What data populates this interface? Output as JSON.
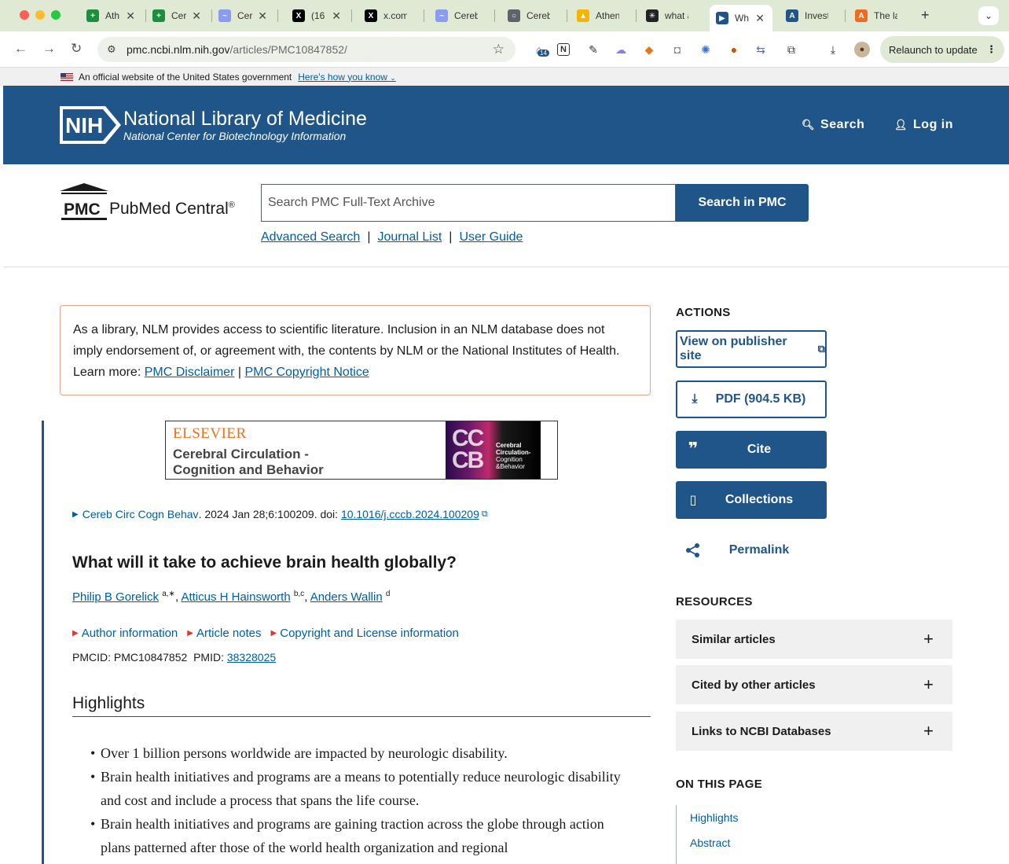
{
  "browser": {
    "tabs": [
      {
        "title": "Ath",
        "color": "#1e8e3e",
        "glyph": "+"
      },
      {
        "title": "Cer",
        "color": "#1e8e3e",
        "glyph": "+"
      },
      {
        "title": "Cer",
        "color": "#8b9cf0",
        "glyph": "~"
      },
      {
        "title": "(16",
        "color": "#000000",
        "glyph": "X"
      },
      {
        "title": "x.com/(",
        "color": "#000000",
        "glyph": "X"
      },
      {
        "title": "Cerebr",
        "color": "#8b9cf0",
        "glyph": "~"
      },
      {
        "title": "Cerebr",
        "color": "#5f6368",
        "glyph": "○"
      },
      {
        "title": "Athena",
        "color": "#f4b400",
        "glyph": "▲"
      },
      {
        "title": "what ar",
        "color": "#222222",
        "glyph": "✳"
      },
      {
        "title": "Wh",
        "color": "#20558a",
        "glyph": "▶"
      },
      {
        "title": "Investir",
        "color": "#20558a",
        "glyph": "A"
      },
      {
        "title": "The late",
        "color": "#f26b1d",
        "glyph": "A"
      }
    ],
    "url_host": "pmc.ncbi.nlm.nih.gov",
    "url_path": "/articles/PMC10847852/",
    "extension_badge": "14",
    "relaunch_label": "Relaunch to update"
  },
  "gov_banner": {
    "text": "An official website of the United States government",
    "link": "Here's how you know"
  },
  "header": {
    "logo_text": "NIH",
    "title": "National Library of Medicine",
    "subtitle": "National Center for Biotechnology Information",
    "search_label": "Search",
    "login_label": "Log in"
  },
  "pmc": {
    "logo_mark": "PMC",
    "logo_word": "PubMed Central",
    "logo_reg": "®",
    "search_placeholder": "Search PMC Full-Text Archive",
    "search_button": "Search in PMC",
    "links": [
      "Advanced Search",
      "Journal List",
      "User Guide"
    ]
  },
  "disclaimer": {
    "text": "As a library, NLM provides access to scientific literature. Inclusion in an NLM database does not imply endorsement of, or agreement with, the contents by NLM or the National Institutes of Health. Learn more: ",
    "link1": "PMC Disclaimer",
    "sep": " | ",
    "link2": "PMC Copyright Notice"
  },
  "journal_banner": {
    "publisher": "ELSEVIER",
    "title_line1": "Cerebral Circulation -",
    "title_line2": "Cognition and Behavior",
    "cover_mark": "CC\nCB",
    "cover_line1": "Cerebral",
    "cover_line2": "Circulation-",
    "cover_line3": "Cognition",
    "cover_line4": "&Behavior"
  },
  "article": {
    "journal": "Cereb Circ Cogn Behav",
    "citation_rest": ". 2024 Jan 28;6:100209. doi: ",
    "doi": "10.1016/j.cccb.2024.100209",
    "title": "What will it take to achieve brain health globally?",
    "authors": [
      {
        "name": "Philip B Gorelick",
        "sup": "a,∗"
      },
      {
        "name": "Atticus H Hainsworth",
        "sup": "b,c"
      },
      {
        "name": "Anders Wallin",
        "sup": "d"
      }
    ],
    "info_links": [
      "Author information",
      "Article notes",
      "Copyright and License information"
    ],
    "pmcid_label": "PMCID:",
    "pmcid": "PMC10847852",
    "pmid_label": "PMID:",
    "pmid": "38328025",
    "highlights_heading": "Highlights",
    "highlights": [
      "Over 1 billion persons worldwide are impacted by neurologic disability.",
      "Brain health initiatives and programs are a means to potentially reduce neurologic disability and cost and include a process that spans the life course.",
      "Brain health initiatives and programs are gaining traction across the globe through action plans patterned after those of the world health organization and regional"
    ]
  },
  "sidebar": {
    "actions_heading": "ACTIONS",
    "publisher_btn": "View on publisher site",
    "pdf_btn": "PDF (904.5 KB)",
    "cite_btn": "Cite",
    "collections_btn": "Collections",
    "permalink_btn": "Permalink",
    "resources_heading": "RESOURCES",
    "resources": [
      "Similar articles",
      "Cited by other articles",
      "Links to NCBI Databases"
    ],
    "on_this_page_heading": "ON THIS PAGE",
    "on_this_page": [
      "Highlights",
      "Abstract"
    ]
  }
}
